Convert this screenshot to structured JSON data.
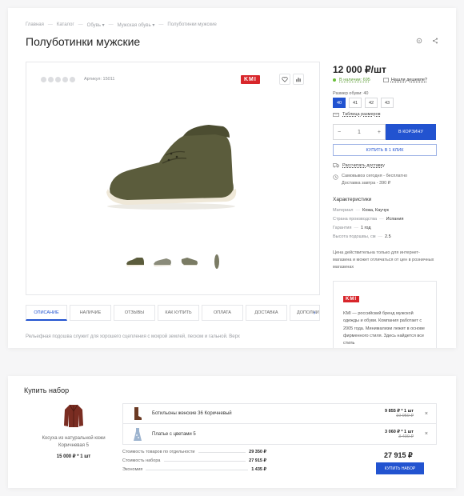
{
  "breadcrumb": [
    "Главная",
    "Каталог",
    "Обувь ▾",
    "Мужская обувь ▾",
    "Полуботинки мужские"
  ],
  "page_title": "Полуботинки мужские",
  "product": {
    "article": "Артикул: 15011",
    "brand_logo": "KMI",
    "price": "12 000 ₽/шт",
    "stock": "В наличии: 695",
    "cheaper": "Нашли дешевле?",
    "size_label": "Размер обуви: 40",
    "sizes": [
      "40",
      "41",
      "42",
      "43"
    ],
    "selected_size": "40",
    "size_table": "Таблица размеров",
    "qty_minus": "−",
    "qty_value": "1",
    "qty_plus": "+",
    "add_to_cart": "В КОРЗИНУ",
    "buy_one_click": "КУПИТЬ В 1 КЛИК",
    "calc_delivery": "Рассчитать доставку",
    "pickup_line1": "Самовывоз сегодня - бесплатно",
    "pickup_line2": "Доставка завтра - 390 ₽",
    "chars_title": "Характеристики",
    "chars": [
      {
        "key": "Материал",
        "value": "Кожа, Каучук"
      },
      {
        "key": "Страна производства",
        "value": "Испания"
      },
      {
        "key": "Гарантия",
        "value": "1 год"
      },
      {
        "key": "Высота подошвы, см",
        "value": "2.5"
      }
    ],
    "price_note": "Цена действительна только для интернет-магазина и может отличаться от цен в розничных магазинах",
    "brand_desc": "KMI — российский бренд мужской одежды и обуви. Компания работает с 2005 года. Минимализм лежит в основе фирменного стиля. Здесь найдется все стиль",
    "description": "Рельефная подошва служит для хорошего сцепления с мокрой землей, песком и гальной. Верх"
  },
  "tabs": [
    "ОПИСАНИЕ",
    "НАЛИЧИЕ",
    "ОТЗЫВЫ",
    "КАК КУПИТЬ",
    "ОПЛАТА",
    "ДОСТАВКА",
    "ДОПОЛНИ"
  ],
  "tab_arrow": "›",
  "kit": {
    "title": "Купить набор",
    "main_name": "Косуха из натуральной кожи Коричневая 5",
    "main_price": "15 000 ₽ * 1 шт",
    "items": [
      {
        "name": "Ботильоны женские 36 Коричневый",
        "price": "9 855 ₽ * 1 шт",
        "old_price": "10 950 ₽",
        "remove": "×"
      },
      {
        "name": "Платье с цветами 5",
        "price": "3 060 ₽ * 1 шт",
        "old_price": "3 400 ₽",
        "remove": "×"
      }
    ],
    "totals": [
      {
        "key": "Стоимость товаров по отдельности",
        "value": "29 350 ₽"
      },
      {
        "key": "Стоимость набора",
        "value": "27 915 ₽"
      },
      {
        "key": "Экономия",
        "value": "1 435 ₽"
      }
    ],
    "total": "27 915 ₽",
    "buy_button": "КУПИТЬ НАБОР"
  },
  "colors": {
    "accent": "#2253d0",
    "brand_red": "#d8262b",
    "stock_green": "#6abf3a"
  }
}
